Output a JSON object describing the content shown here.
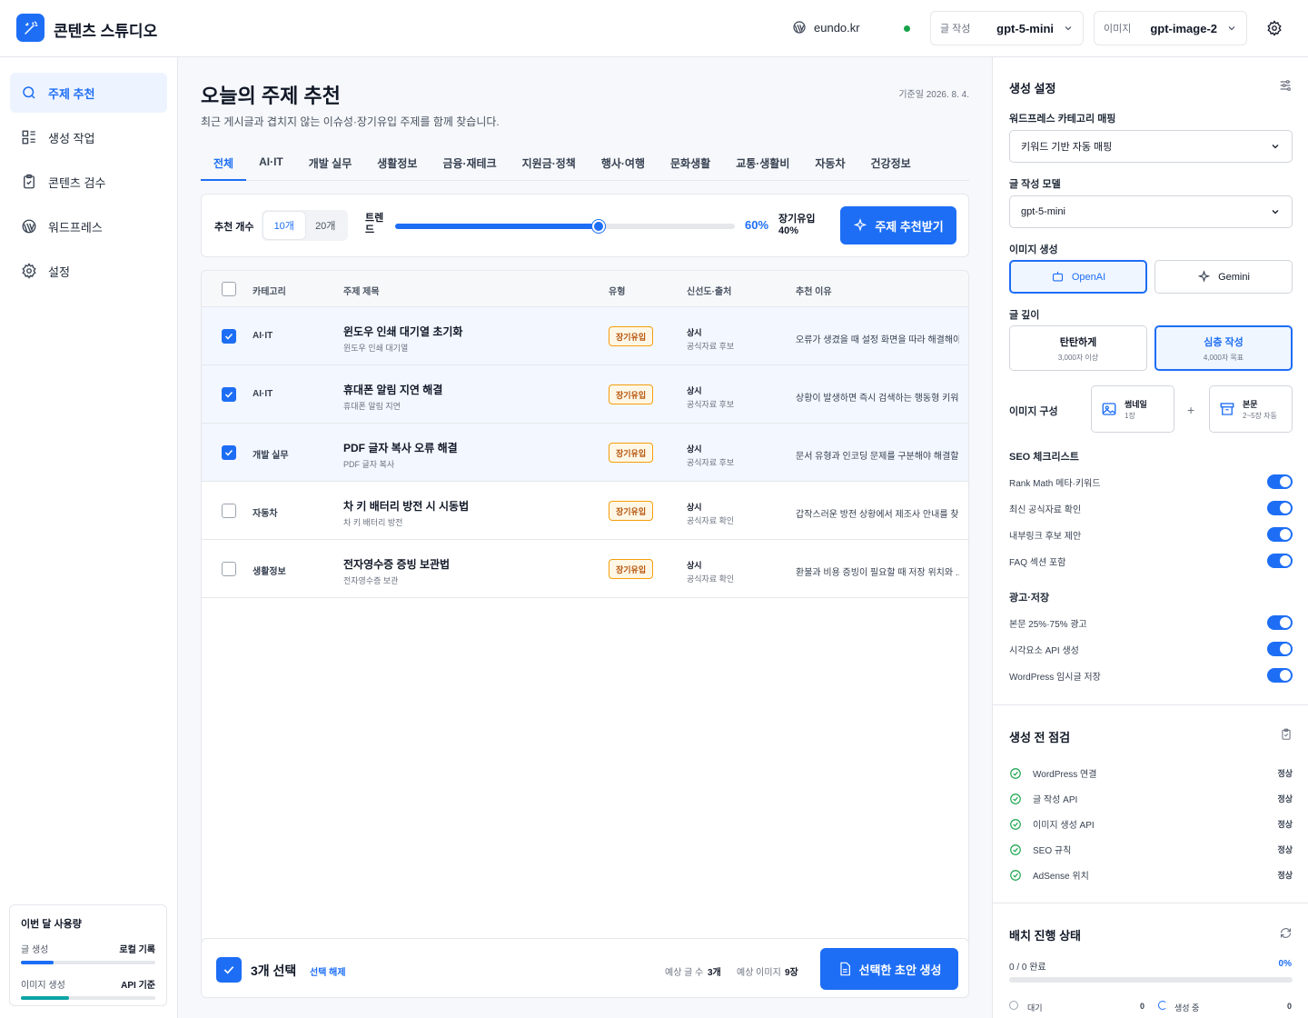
{
  "app": {
    "title": "콘텐츠 스튜디오"
  },
  "top": {
    "site": "eundo.kr",
    "writing_label": "글 작성",
    "writing_model": "gpt-5-mini",
    "image_label": "이미지",
    "image_model": "gpt-image-2"
  },
  "sidebar": {
    "items": [
      {
        "label": "주제 추천",
        "icon": "search-icon"
      },
      {
        "label": "생성 작업",
        "icon": "grid-icon"
      },
      {
        "label": "콘텐츠 검수",
        "icon": "clipboard-icon"
      },
      {
        "label": "워드프레스",
        "icon": "wordpress-icon"
      },
      {
        "label": "설정",
        "icon": "gear-icon"
      }
    ],
    "usage": {
      "title": "이번 달 사용량",
      "writing": "글 생성",
      "writing_val": "로컬 기록",
      "writing_pct": 0.24,
      "image": "이미지 생성",
      "image_val": "API 기준",
      "image_pct": 0.36
    }
  },
  "main": {
    "title": "오늘의 주제 추천",
    "date": "기준일 2026. 8. 4.",
    "subtitle": "최근 게시글과 겹치지 않는 이슈성·장기유입 주제를 함께 찾습니다.",
    "tabs": [
      "전체",
      "AI·IT",
      "개발 실무",
      "생활정보",
      "금융·재테크",
      "지원금·정책",
      "행사·여행",
      "문화생활",
      "교통·생활비",
      "자동차",
      "건강정보"
    ],
    "count_label": "추천 개수",
    "count_options": [
      "10개",
      "20개"
    ],
    "trend_label": "트렌드",
    "trend_pct": "60%",
    "trend_value": 0.6,
    "long_label": "장기유입",
    "long_pct": "40%",
    "recommend_button": "주제 추천받기",
    "headers": [
      "카테고리",
      "주제 제목",
      "유형",
      "신선도·출처",
      "추천 이유"
    ],
    "rows": [
      {
        "checked": true,
        "category": "AI·IT",
        "title": "윈도우 인쇄 대기열 초기화",
        "keyword": "윈도우 인쇄 대기열",
        "type": "장기유입",
        "fresh": "상시",
        "source": "공식자료 후보",
        "reason": "오류가 생겼을 때 설정 화면을 따라 해결해야..."
      },
      {
        "checked": true,
        "category": "AI·IT",
        "title": "휴대폰 알림 지연 해결",
        "keyword": "휴대폰 알림 지연",
        "type": "장기유입",
        "fresh": "상시",
        "source": "공식자료 후보",
        "reason": "상황이 발생하면 즉시 검색하는 행동형 키워드"
      },
      {
        "checked": true,
        "category": "개발 실무",
        "title": "PDF 글자 복사 오류 해결",
        "keyword": "PDF 글자 복사",
        "type": "장기유입",
        "fresh": "상시",
        "source": "공식자료 후보",
        "reason": "문서 유형과 인코딩 문제를 구분해야 해결할 ..."
      },
      {
        "checked": false,
        "category": "자동차",
        "title": "차 키 배터리 방전 시 시동법",
        "keyword": "차 키 배터리 방전",
        "type": "장기유입",
        "fresh": "상시",
        "source": "공식자료 확인",
        "reason": "갑작스러운 방전 상황에서 제조사 안내를 찾..."
      },
      {
        "checked": false,
        "category": "생활정보",
        "title": "전자영수증 증빙 보관법",
        "keyword": "전자영수증 보관",
        "type": "장기유입",
        "fresh": "상시",
        "source": "공식자료 확인",
        "reason": "환불과 비용 증빙이 필요할 때 저장 위치와 ..."
      }
    ],
    "bottom": {
      "selected": "3개 선택",
      "clear": "선택 해제",
      "est_text_label": "예상 글 수",
      "est_text": "3개",
      "est_img_label": "예상 이미지",
      "est_img": "9장",
      "generate": "선택한 초안 생성"
    }
  },
  "right": {
    "settings_title": "생성 설정",
    "wp_cat_label": "워드프레스 카테고리 매핑",
    "wp_cat_value": "키워드 기반 자동 매핑",
    "model_label": "글 작성 모델",
    "model_value": "gpt-5-mini",
    "image_gen_label": "이미지 생성",
    "image_opts": [
      "OpenAI",
      "Gemini"
    ],
    "depth_label": "글 깊이",
    "depth_opts": [
      {
        "t": "탄탄하게",
        "s": "3,000자 이상"
      },
      {
        "t": "심층 작성",
        "s": "4,000자 목표"
      }
    ],
    "img_comp_label": "이미지 구성",
    "thumb": {
      "t": "썸네일",
      "s": "1장"
    },
    "body": {
      "t": "본문",
      "s": "2~5장 자동"
    },
    "plus": "+",
    "seo_title": "SEO 체크리스트",
    "seo_items": [
      "Rank Math 메타·키워드",
      "최신 공식자료 확인",
      "내부링크 후보 제안",
      "FAQ 섹션 포함"
    ],
    "ad_title": "광고·저장",
    "ad_items": [
      "본문 25%·75% 광고",
      "시각요소 API 생성",
      "WordPress 임시글 저장"
    ],
    "precheck_title": "생성 전 점검",
    "precheck_items": [
      "WordPress 연결",
      "글 작성 API",
      "이미지 생성 API",
      "SEO 규칙",
      "AdSense 위치"
    ],
    "precheck_status": "정상",
    "batch_title": "배치 진행 상태",
    "batch_done": "0 / 0 완료",
    "batch_pct": "0%",
    "wait_label": "대기",
    "wait_val": "0",
    "running_label": "생성 중",
    "running_val": "0"
  }
}
